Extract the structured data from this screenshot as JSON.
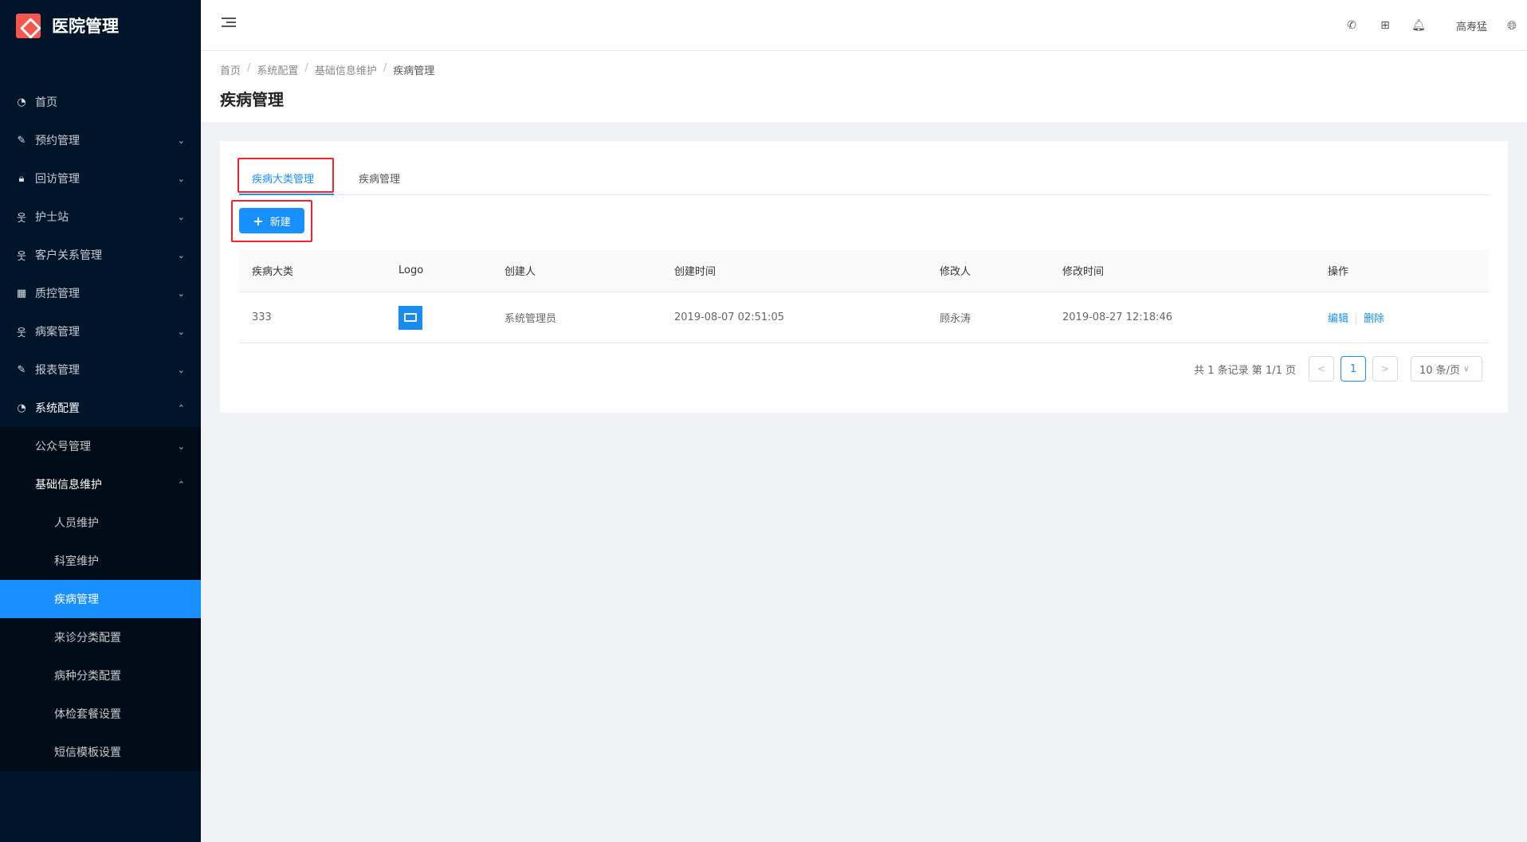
{
  "app": {
    "title": "医院管理"
  },
  "sidebar": {
    "items": [
      {
        "label": "首页",
        "icon": "dashboard-icon"
      },
      {
        "label": "预约管理",
        "icon": "edit-icon"
      },
      {
        "label": "回访管理",
        "icon": "lock-icon"
      },
      {
        "label": "护士站",
        "icon": "user-icon"
      },
      {
        "label": "客户关系管理",
        "icon": "user-icon"
      },
      {
        "label": "质控管理",
        "icon": "table-icon"
      },
      {
        "label": "病案管理",
        "icon": "user-icon"
      },
      {
        "label": "报表管理",
        "icon": "edit-icon"
      },
      {
        "label": "系统配置",
        "icon": "dashboard-icon"
      }
    ],
    "sub": [
      {
        "label": "公众号管理"
      },
      {
        "label": "基础信息维护"
      }
    ],
    "leaf": [
      {
        "label": "人员维护"
      },
      {
        "label": "科室维护"
      },
      {
        "label": "疾病管理"
      },
      {
        "label": "来诊分类配置"
      },
      {
        "label": "病种分类配置"
      },
      {
        "label": "体检套餐设置"
      },
      {
        "label": "短信模板设置"
      }
    ]
  },
  "header": {
    "user": "高寿猛"
  },
  "breadcrumb": [
    "首页",
    "系统配置",
    "基础信息维护",
    "疾病管理"
  ],
  "page": {
    "title": "疾病管理"
  },
  "tabs": [
    "疾病大类管理",
    "疾病管理"
  ],
  "toolbar": {
    "new_label": "新建",
    "plus": "+"
  },
  "table": {
    "columns": [
      "疾病大类",
      "Logo",
      "创建人",
      "创建时间",
      "修改人",
      "修改时间",
      "操作"
    ],
    "rows": [
      {
        "category": "333",
        "creator": "系统管理员",
        "created": "2019-08-07 02:51:05",
        "modifier": "顾永涛",
        "modified": "2019-08-27 12:18:46",
        "edit": "编辑",
        "delete": "删除"
      }
    ]
  },
  "pagination": {
    "summary": "共 1 条记录 第 1/1 页",
    "current": "1",
    "page_size": "10 条/页"
  },
  "colors": {
    "primary": "#1890ff",
    "sidebar_bg": "#001529",
    "highlight": "#f5222d"
  }
}
